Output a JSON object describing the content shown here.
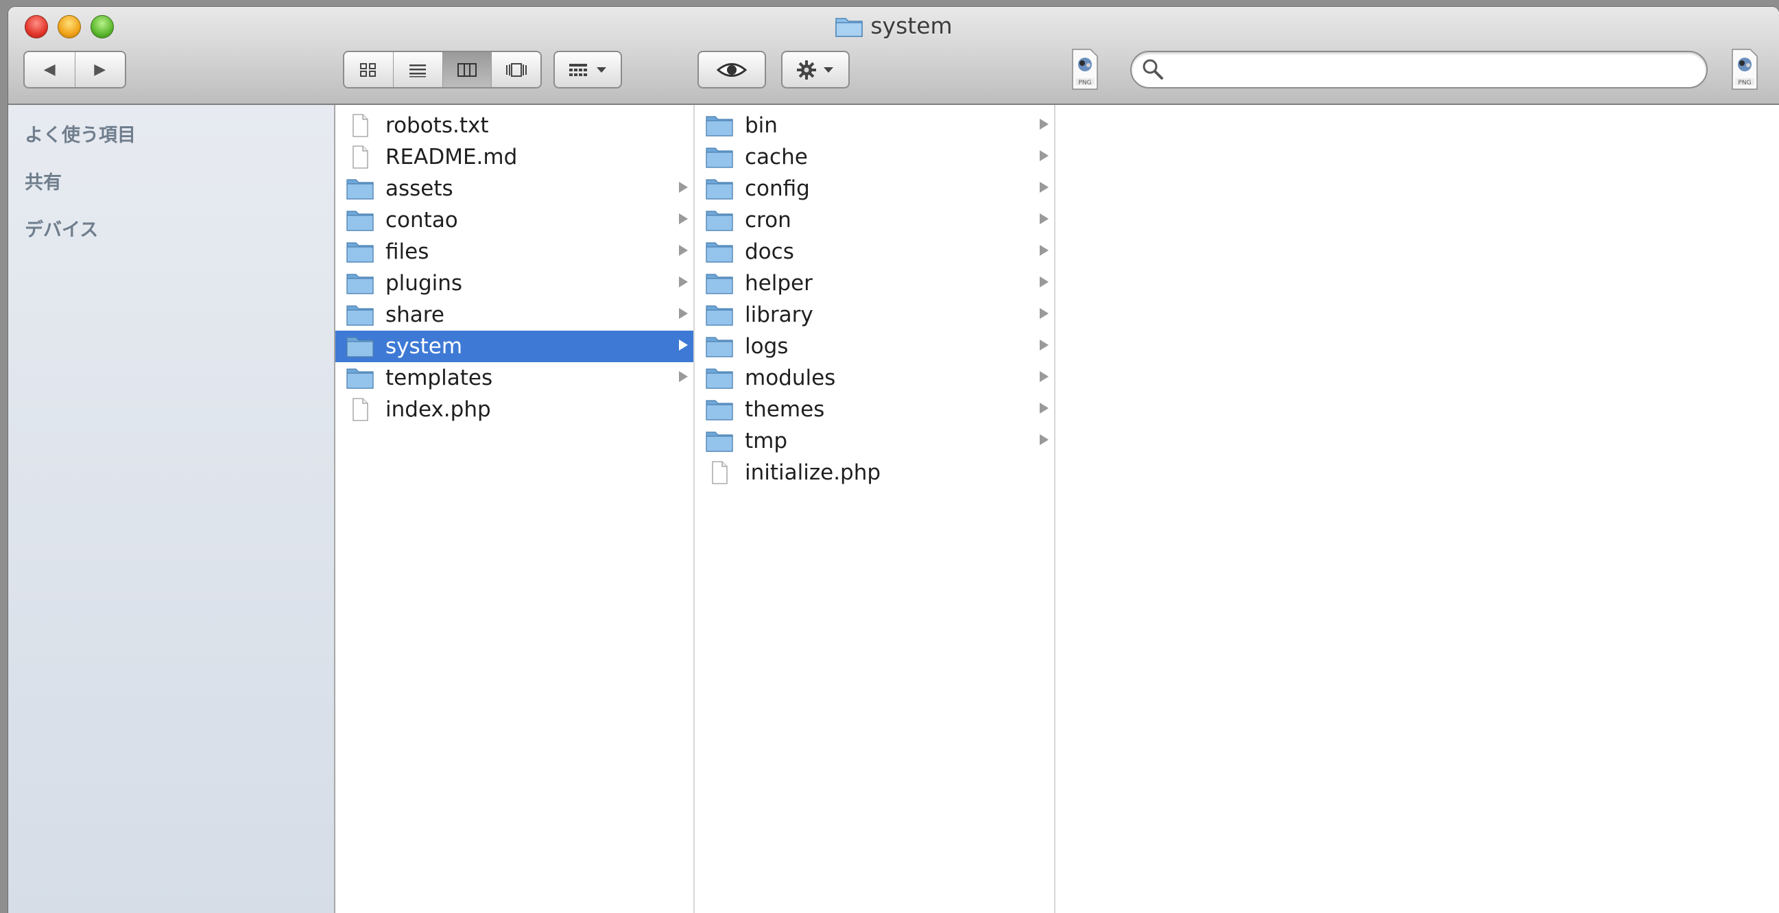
{
  "window": {
    "title": "system"
  },
  "toolbar": {
    "back_glyph": "◀",
    "forward_glyph": "▶",
    "search": {
      "placeholder": "",
      "value": ""
    }
  },
  "sidebar": {
    "sections": [
      "よく使う項目",
      "共有",
      "デバイス"
    ]
  },
  "columns": [
    {
      "items": [
        {
          "name": "robots.txt",
          "kind": "file",
          "selected": false
        },
        {
          "name": "README.md",
          "kind": "file",
          "selected": false
        },
        {
          "name": "assets",
          "kind": "folder",
          "selected": false
        },
        {
          "name": "contao",
          "kind": "folder",
          "selected": false
        },
        {
          "name": "files",
          "kind": "folder",
          "selected": false
        },
        {
          "name": "plugins",
          "kind": "folder",
          "selected": false
        },
        {
          "name": "share",
          "kind": "folder",
          "selected": false
        },
        {
          "name": "system",
          "kind": "folder",
          "selected": true
        },
        {
          "name": "templates",
          "kind": "folder",
          "selected": false
        },
        {
          "name": "index.php",
          "kind": "file",
          "selected": false
        }
      ]
    },
    {
      "items": [
        {
          "name": "bin",
          "kind": "folder",
          "selected": false
        },
        {
          "name": "cache",
          "kind": "folder",
          "selected": false
        },
        {
          "name": "config",
          "kind": "folder",
          "selected": false
        },
        {
          "name": "cron",
          "kind": "folder",
          "selected": false
        },
        {
          "name": "docs",
          "kind": "folder",
          "selected": false
        },
        {
          "name": "helper",
          "kind": "folder",
          "selected": false
        },
        {
          "name": "library",
          "kind": "folder",
          "selected": false
        },
        {
          "name": "logs",
          "kind": "folder",
          "selected": false
        },
        {
          "name": "modules",
          "kind": "folder",
          "selected": false
        },
        {
          "name": "themes",
          "kind": "folder",
          "selected": false
        },
        {
          "name": "tmp",
          "kind": "folder",
          "selected": false
        },
        {
          "name": "initialize.php",
          "kind": "file",
          "selected": false
        }
      ]
    }
  ],
  "colors": {
    "selection": "#3e7ad5",
    "folder": "#7fb3e0",
    "sidebar_heading": "#6f7d8c"
  }
}
